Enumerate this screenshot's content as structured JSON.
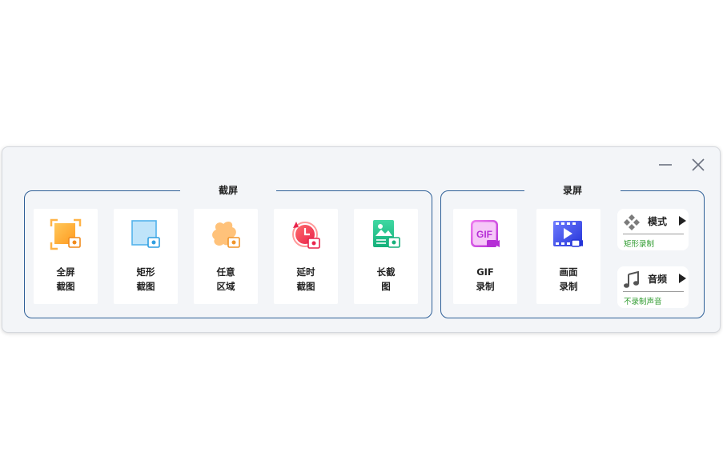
{
  "window": {
    "controls": {
      "minimize": "minimize",
      "close": "close"
    }
  },
  "capture": {
    "title": "截屏",
    "tools": [
      {
        "line1": "全屏",
        "line2": "截图",
        "icon": "fullscreen-capture-icon"
      },
      {
        "line1": "矩形",
        "line2": "截图",
        "icon": "rectangle-capture-icon"
      },
      {
        "line1": "任意",
        "line2": "区域",
        "icon": "freeform-capture-icon"
      },
      {
        "line1": "延时",
        "line2": "截图",
        "icon": "delay-capture-icon"
      },
      {
        "line1": "长截",
        "line2": "图",
        "icon": "scroll-capture-icon"
      }
    ]
  },
  "record": {
    "title": "录屏",
    "tools": [
      {
        "line1": "GIF",
        "line2": "录制",
        "icon": "gif-record-icon",
        "icon_text": "GIF"
      },
      {
        "line1": "画面",
        "line2": "录制",
        "icon": "screen-record-icon"
      }
    ],
    "mode": {
      "label": "模式",
      "value": "矩形录制",
      "icon": "mode-diamond-icon"
    },
    "audio": {
      "label": "音频",
      "value": "不录制声音",
      "icon": "music-note-icon"
    }
  },
  "colors": {
    "group_border": "#2e5f97",
    "option_value": "#2c9a2c",
    "window_bg": "#f3f5f8"
  }
}
